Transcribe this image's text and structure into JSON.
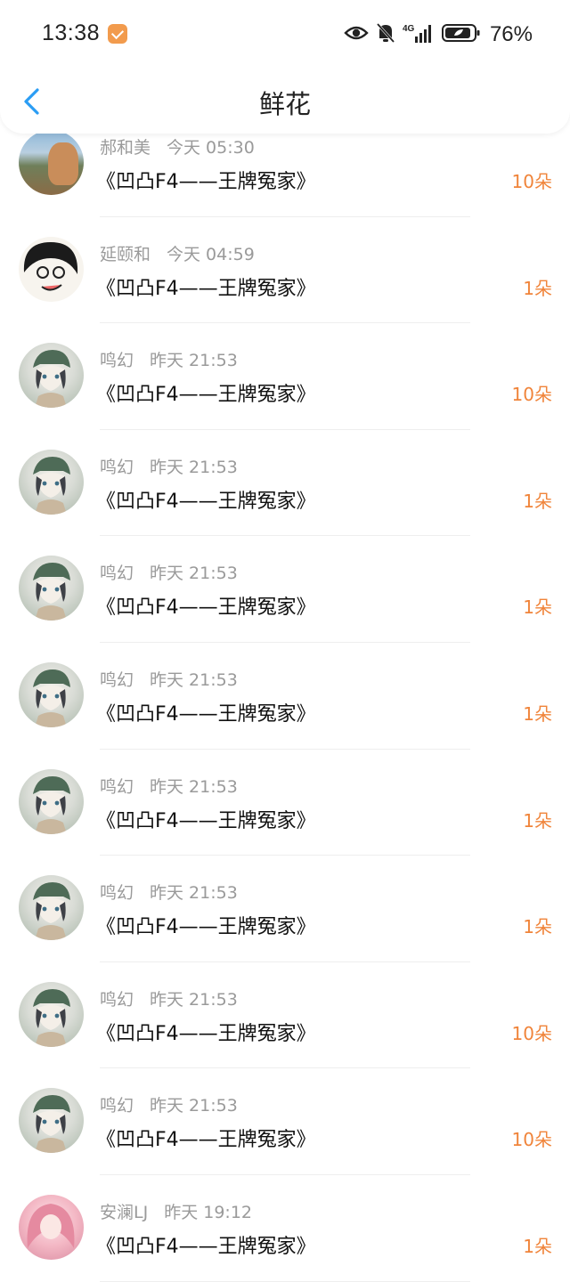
{
  "status_bar": {
    "time": "13:38",
    "network": "4G",
    "battery_percent": "76%"
  },
  "nav": {
    "title": "鲜花",
    "back_icon": "chevron-left-icon"
  },
  "colors": {
    "accent_back": "#2a9df4",
    "amount": "#f0843a",
    "meta": "#9a9a9a"
  },
  "items": [
    {
      "name": "郝和美",
      "time": "今天 05:30",
      "work": "《凹凸F4——王牌冤家》",
      "amount": "10朵",
      "avatar": "landscape"
    },
    {
      "name": "延颐和",
      "time": "今天 04:59",
      "work": "《凹凸F4——王牌冤家》",
      "amount": "1朵",
      "avatar": "cartoon"
    },
    {
      "name": "鸣幻",
      "time": "昨天 21:53",
      "work": "《凹凸F4——王牌冤家》",
      "amount": "10朵",
      "avatar": "anime"
    },
    {
      "name": "鸣幻",
      "time": "昨天 21:53",
      "work": "《凹凸F4——王牌冤家》",
      "amount": "1朵",
      "avatar": "anime"
    },
    {
      "name": "鸣幻",
      "time": "昨天 21:53",
      "work": "《凹凸F4——王牌冤家》",
      "amount": "1朵",
      "avatar": "anime"
    },
    {
      "name": "鸣幻",
      "time": "昨天 21:53",
      "work": "《凹凸F4——王牌冤家》",
      "amount": "1朵",
      "avatar": "anime"
    },
    {
      "name": "鸣幻",
      "time": "昨天 21:53",
      "work": "《凹凸F4——王牌冤家》",
      "amount": "1朵",
      "avatar": "anime"
    },
    {
      "name": "鸣幻",
      "time": "昨天 21:53",
      "work": "《凹凸F4——王牌冤家》",
      "amount": "1朵",
      "avatar": "anime"
    },
    {
      "name": "鸣幻",
      "time": "昨天 21:53",
      "work": "《凹凸F4——王牌冤家》",
      "amount": "10朵",
      "avatar": "anime"
    },
    {
      "name": "鸣幻",
      "time": "昨天 21:53",
      "work": "《凹凸F4——王牌冤家》",
      "amount": "10朵",
      "avatar": "anime"
    },
    {
      "name": "安澜LJ",
      "time": "昨天 19:12",
      "work": "《凹凸F4——王牌冤家》",
      "amount": "1朵",
      "avatar": "pink"
    }
  ]
}
